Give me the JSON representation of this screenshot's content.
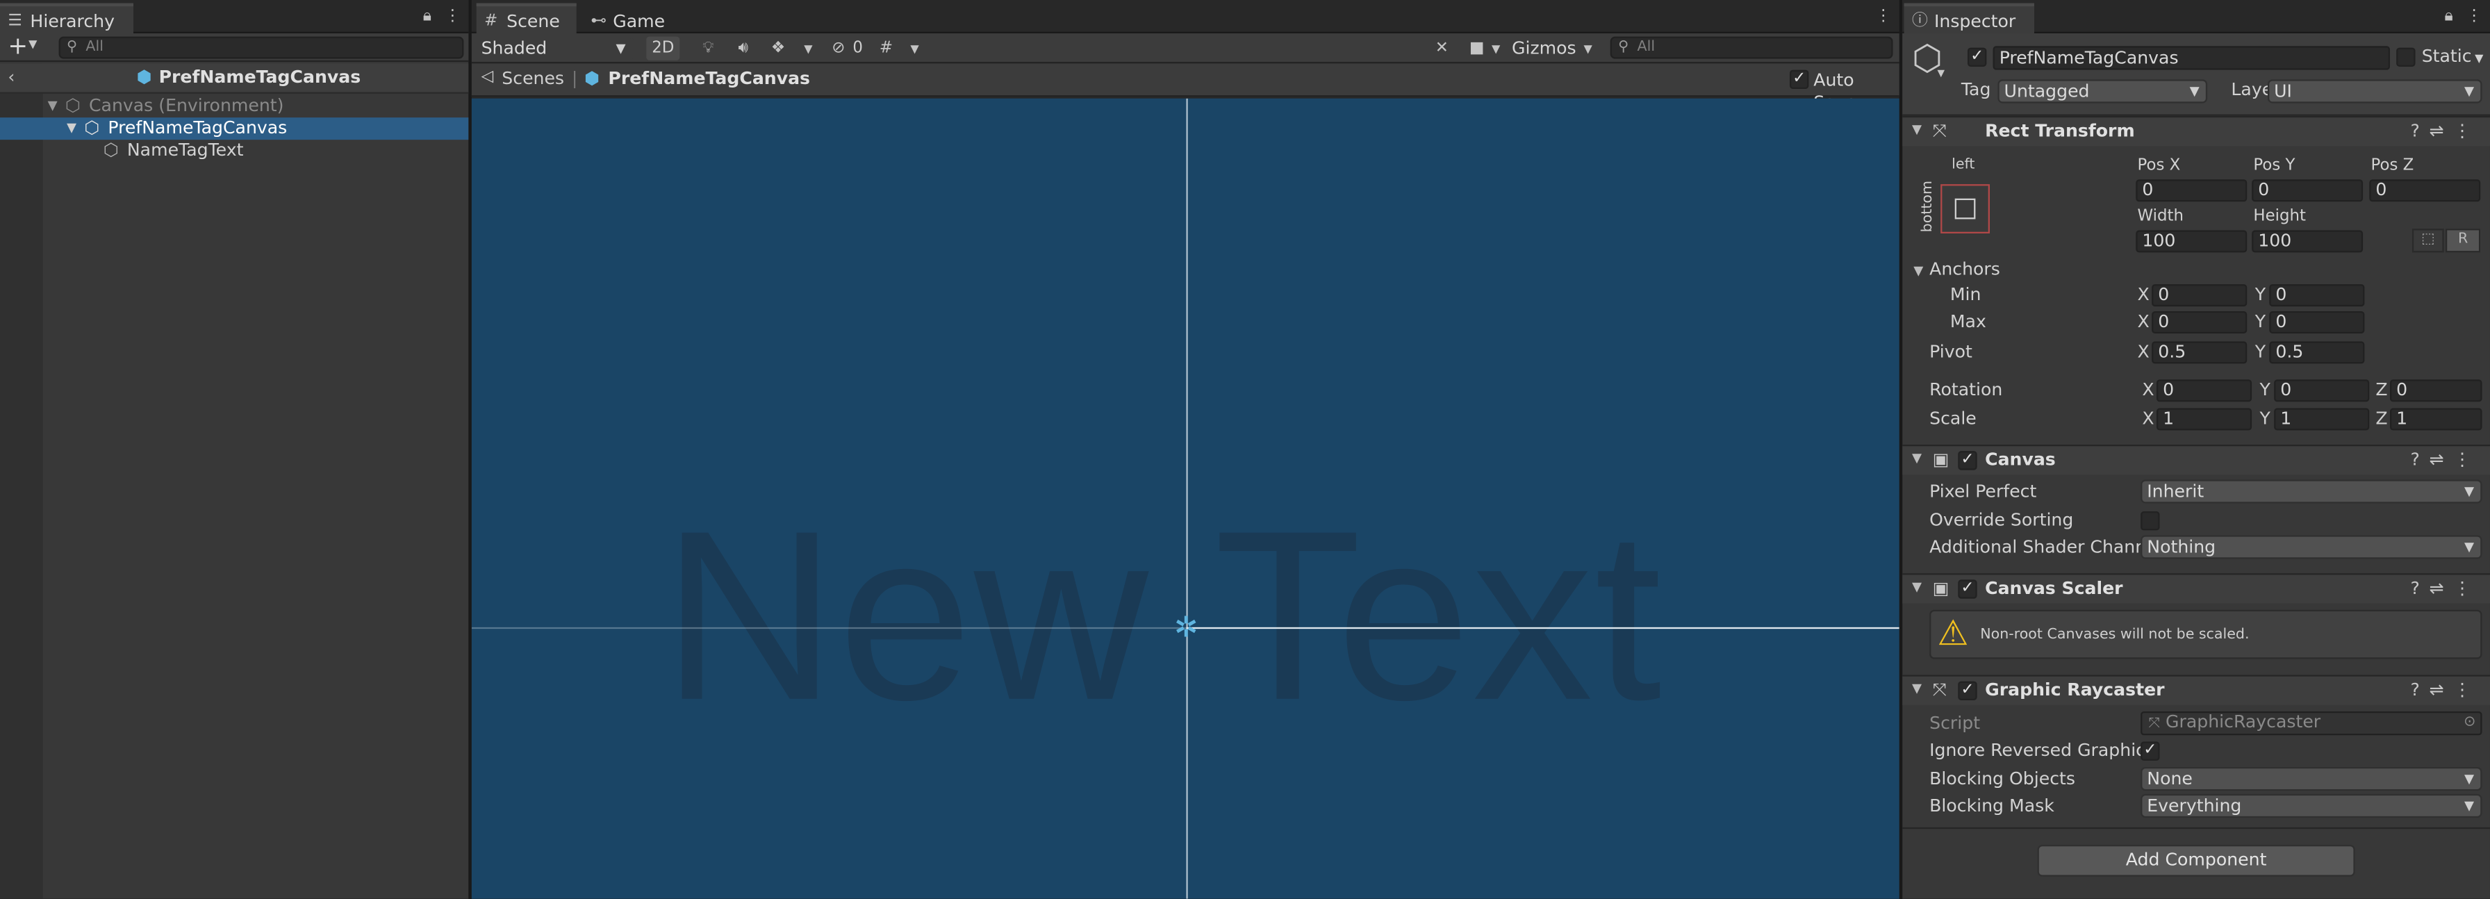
{
  "colors": {
    "panel": "#383838",
    "selection": "#2c5d87",
    "scene_bg": "#1a4566",
    "accent_blue": "#5fb5e0",
    "warning": "#f0c020"
  },
  "hierarchy": {
    "tab_label": "Hierarchy",
    "add_label": "+",
    "search_placeholder": "All",
    "scene_name": "PrefNameTagCanvas",
    "items": [
      {
        "label": "Canvas (Environment)",
        "icon": "cube-icon"
      },
      {
        "label": "PrefNameTagCanvas",
        "icon": "prefab-icon",
        "selected": true
      },
      {
        "label": "NameTagText",
        "icon": "cube-icon"
      }
    ]
  },
  "scene": {
    "tab_scene": "Scene",
    "tab_game": "Game",
    "shading_mode": "Shaded",
    "mode_2d": "2D",
    "hidden_count": "0",
    "gizmos_label": "Gizmos",
    "search_placeholder": "All",
    "breadcrumb_root": "Scenes",
    "breadcrumb_prefab": "PrefNameTagCanvas",
    "auto_save_label": "Auto Save",
    "canvas_text": "New Text"
  },
  "inspector": {
    "tab_label": "Inspector",
    "object_name": "PrefNameTagCanvas",
    "static_label": "Static",
    "tag_label": "Tag",
    "tag_value": "Untagged",
    "layer_label": "Layer",
    "layer_value": "UI",
    "rect_transform": {
      "title": "Rect Transform",
      "anchor_preset_top": "left",
      "anchor_preset_side": "bottom",
      "pos_x_label": "Pos X",
      "pos_y_label": "Pos Y",
      "pos_z_label": "Pos Z",
      "pos_x": "0",
      "pos_y": "0",
      "pos_z": "0",
      "width_label": "Width",
      "height_label": "Height",
      "width": "100",
      "height": "100",
      "r_label": "R",
      "anchors_label": "Anchors",
      "min_label": "Min",
      "max_label": "Max",
      "min_x": "0",
      "min_y": "0",
      "max_x": "0",
      "max_y": "0",
      "pivot_label": "Pivot",
      "pivot_x": "0.5",
      "pivot_y": "0.5",
      "rotation_label": "Rotation",
      "rot_x": "0",
      "rot_y": "0",
      "rot_z": "0",
      "scale_label": "Scale",
      "scale_x": "1",
      "scale_y": "1",
      "scale_z": "1",
      "x": "X",
      "y": "Y",
      "z": "Z"
    },
    "canvas": {
      "title": "Canvas",
      "pixel_perfect_label": "Pixel Perfect",
      "pixel_perfect_value": "Inherit",
      "override_sorting_label": "Override Sorting",
      "shader_channel_label": "Additional Shader Channel",
      "shader_channel_value": "Nothing"
    },
    "canvas_scaler": {
      "title": "Canvas Scaler",
      "warning": "Non-root Canvases will not be scaled."
    },
    "graphic_raycaster": {
      "title": "Graphic Raycaster",
      "script_label": "Script",
      "script_value": "GraphicRaycaster",
      "ignore_reversed_label": "Ignore Reversed Graphics",
      "blocking_objects_label": "Blocking Objects",
      "blocking_objects_value": "None",
      "blocking_mask_label": "Blocking Mask",
      "blocking_mask_value": "Everything"
    },
    "add_component_label": "Add Component"
  }
}
